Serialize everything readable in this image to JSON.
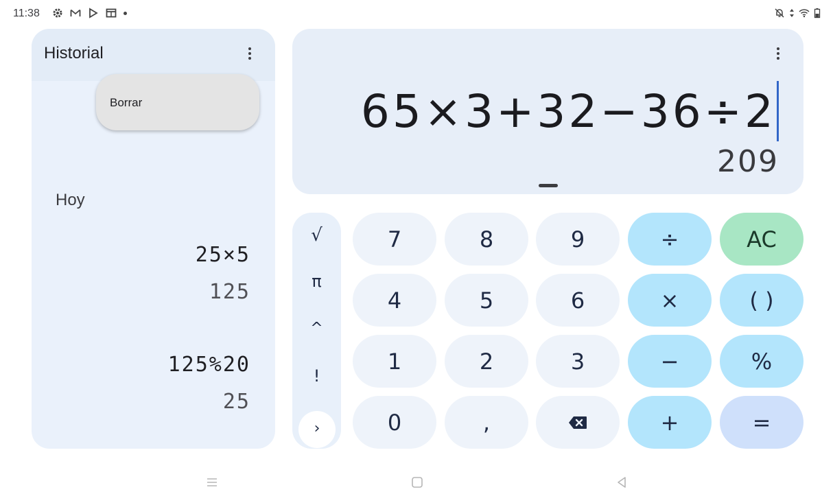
{
  "status_bar": {
    "time": "11:38",
    "left_icons": [
      "settings-icon",
      "gmail-icon",
      "play-store-icon",
      "window-icon",
      "notification-dot"
    ],
    "right_icons": [
      "notifications-off-icon",
      "data-arrows-icon",
      "wifi-icon",
      "battery-icon"
    ]
  },
  "history": {
    "title": "Historial",
    "menu_popup_label": "Borrar",
    "section_label": "Hoy",
    "entries": [
      {
        "expression": "25×5",
        "result": "125"
      },
      {
        "expression": "125%20",
        "result": "25"
      }
    ]
  },
  "display": {
    "expression": "65×3+32−36÷2",
    "result": "209"
  },
  "scientific_keys": [
    "√",
    "π",
    "^",
    "!",
    "›"
  ],
  "keypad": {
    "rows": [
      [
        "7",
        "8",
        "9",
        "÷",
        "AC"
      ],
      [
        "4",
        "5",
        "6",
        "×",
        "( )"
      ],
      [
        "1",
        "2",
        "3",
        "−",
        "%"
      ],
      [
        "0",
        ",",
        "⌫",
        "+",
        "="
      ]
    ]
  },
  "colors": {
    "number_key": "#eef3fa",
    "operator_key": "#b3e5fc",
    "clear_key": "#a8e6c4",
    "equals_key": "#cfe0fb",
    "panel": "#e7eef8",
    "cursor": "#3266c8"
  },
  "nav_bar": [
    "menu-icon",
    "home-icon",
    "back-icon"
  ]
}
